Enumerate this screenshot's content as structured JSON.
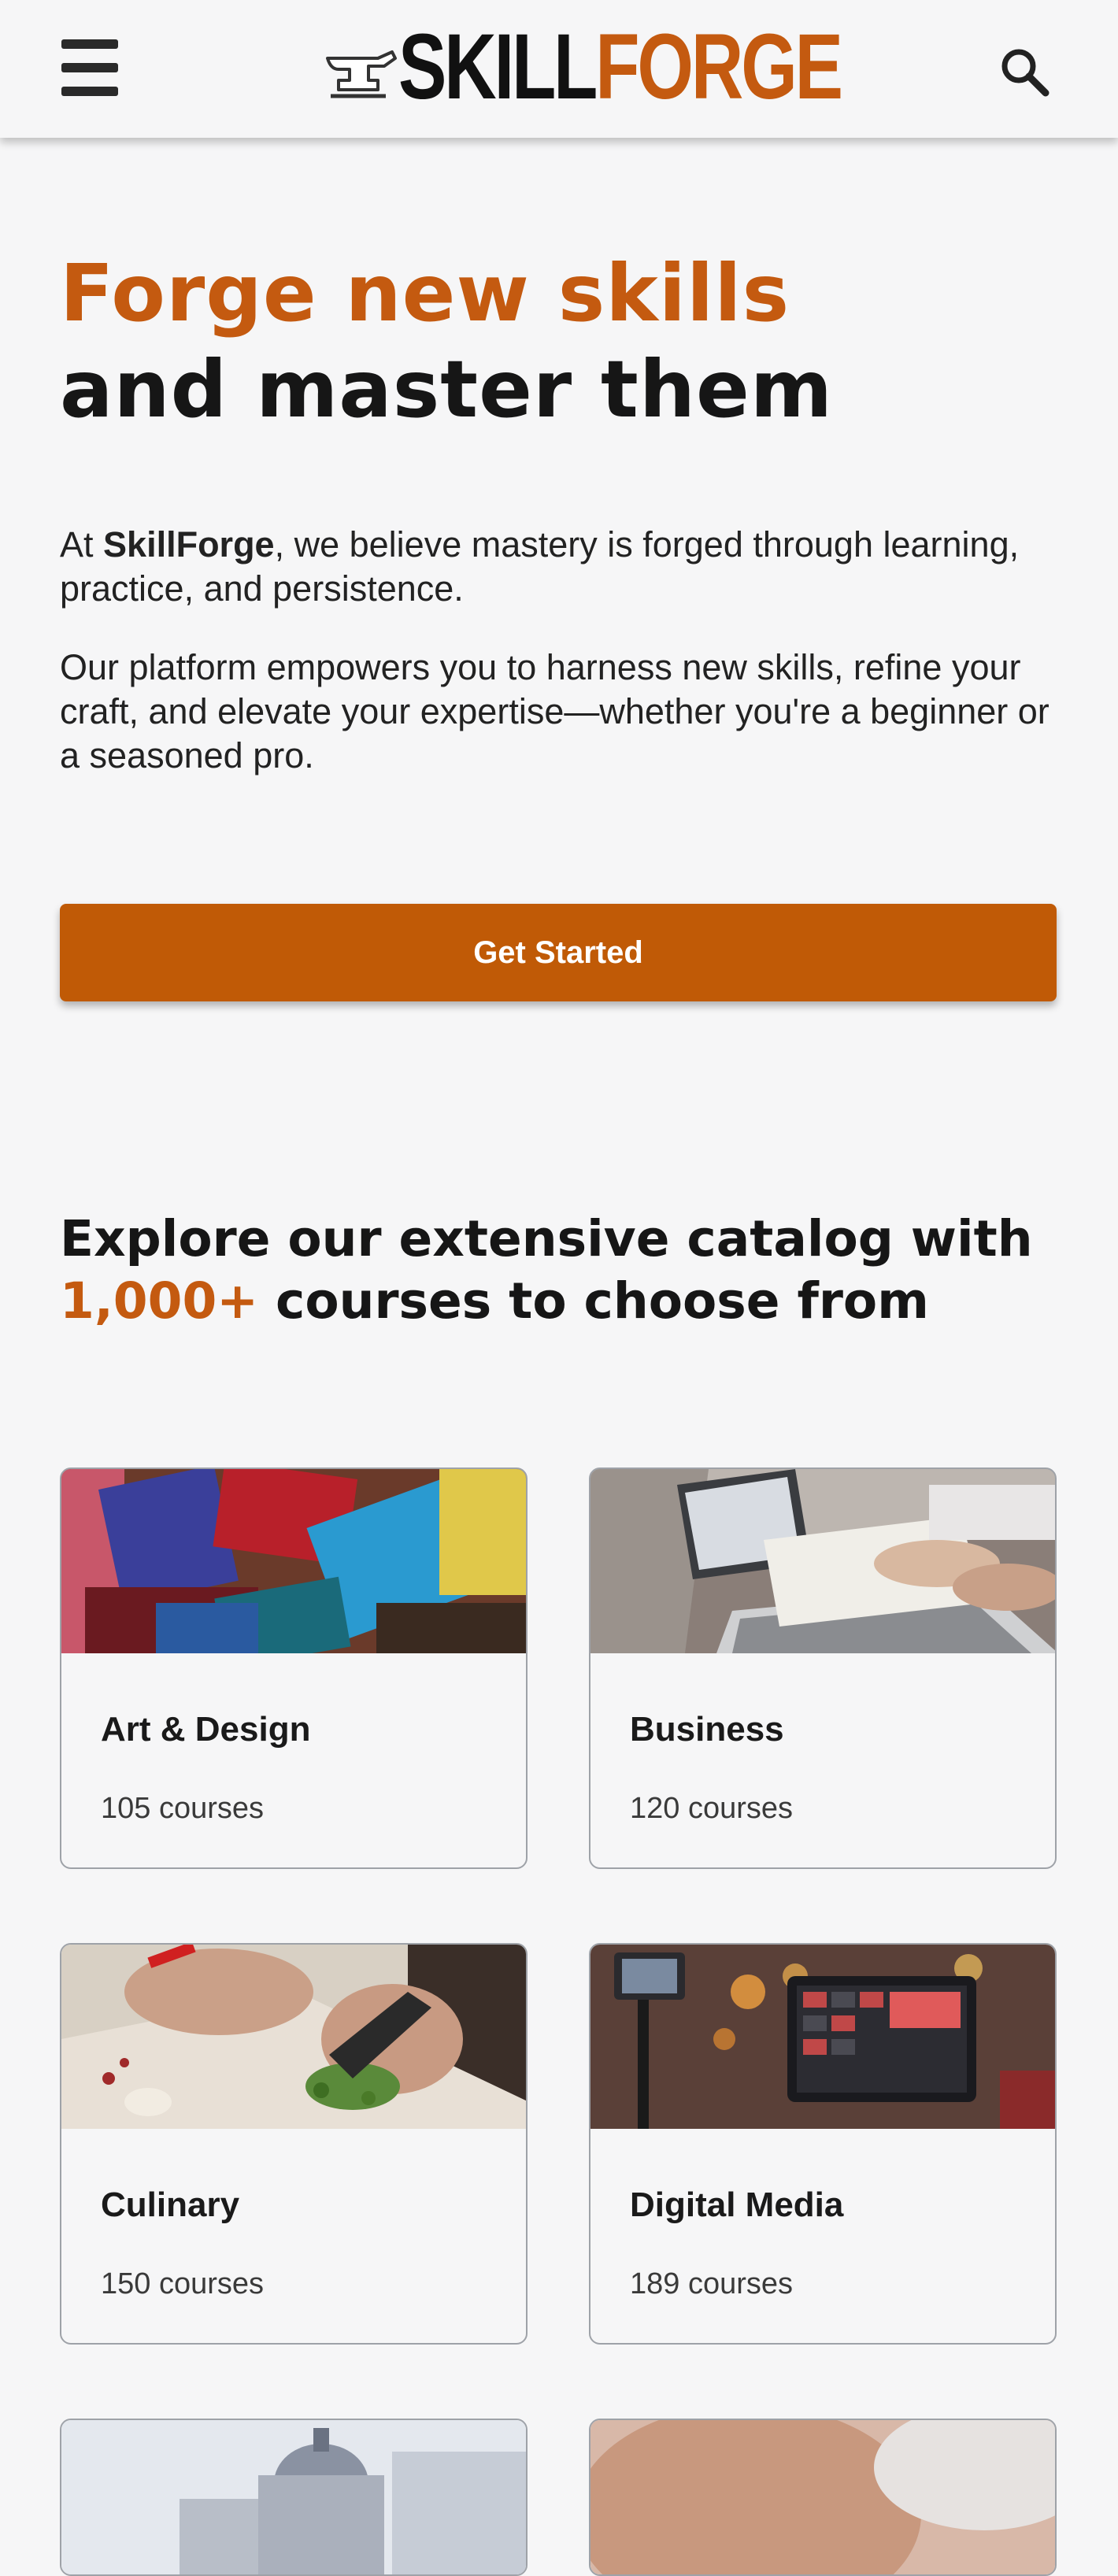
{
  "header": {
    "logo_skill": "SKILL",
    "logo_forge": "FORGE",
    "menu_icon": "hamburger-menu-icon",
    "search_icon": "search-icon",
    "brand_color": "#c45a10"
  },
  "hero": {
    "title_accent": "Forge new skills",
    "title_rest": "and master them",
    "p1_prefix": "At ",
    "p1_brand": "SkillForge",
    "p1_suffix": ", we believe mastery is forged through learning, practice, and persistence.",
    "p2": "Our platform empowers you to harness new skills, refine your craft, and elevate your expertise—whether you're a beginner or a seasoned pro.",
    "cta_label": "Get Started",
    "cta_color": "#c05a06"
  },
  "catalog": {
    "heading_prefix": "Explore our extensive catalog with ",
    "heading_number": "1,000+",
    "heading_suffix": " courses to choose from",
    "categories": [
      {
        "name": "Art & Design",
        "count": "105 courses"
      },
      {
        "name": "Business",
        "count": "120 courses"
      },
      {
        "name": "Culinary",
        "count": "150 courses"
      },
      {
        "name": "Digital Media",
        "count": "189 courses"
      }
    ]
  }
}
